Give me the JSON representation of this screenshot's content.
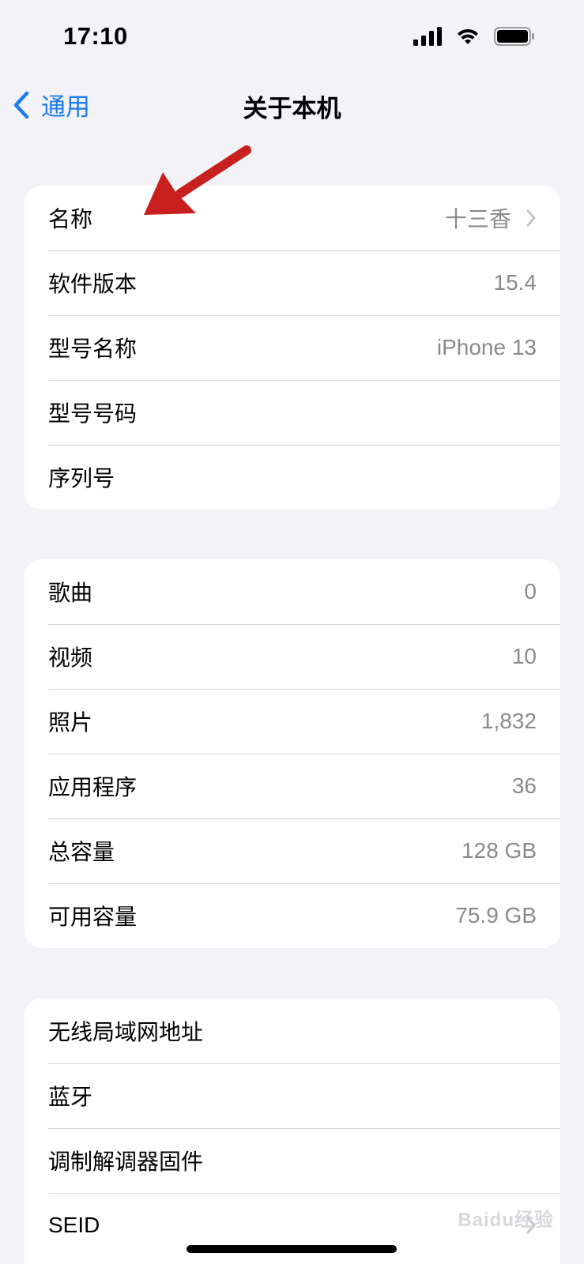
{
  "status_bar": {
    "time": "17:10",
    "icons": [
      "cellular-signal-icon",
      "wifi-icon",
      "battery-icon"
    ]
  },
  "nav": {
    "back_label": "通用",
    "title": "关于本机"
  },
  "groups": [
    {
      "rows": [
        {
          "label": "名称",
          "value": "十三香",
          "chevron": true
        },
        {
          "label": "软件版本",
          "value": "15.4"
        },
        {
          "label": "型号名称",
          "value": "iPhone 13"
        },
        {
          "label": "型号号码",
          "value": ""
        },
        {
          "label": "序列号",
          "value": ""
        }
      ]
    },
    {
      "rows": [
        {
          "label": "歌曲",
          "value": "0"
        },
        {
          "label": "视频",
          "value": "10"
        },
        {
          "label": "照片",
          "value": "1,832"
        },
        {
          "label": "应用程序",
          "value": "36"
        },
        {
          "label": "总容量",
          "value": "128 GB"
        },
        {
          "label": "可用容量",
          "value": "75.9 GB"
        }
      ]
    },
    {
      "rows": [
        {
          "label": "无线局域网地址",
          "value": ""
        },
        {
          "label": "蓝牙",
          "value": ""
        },
        {
          "label": "调制解调器固件",
          "value": ""
        },
        {
          "label": "SEID",
          "value": "",
          "chevron": true
        }
      ]
    }
  ],
  "colors": {
    "accent": "#1d7cf2",
    "background": "#f2f2f7",
    "annotation_arrow": "#c8201e"
  },
  "watermark": "Baidu经验"
}
